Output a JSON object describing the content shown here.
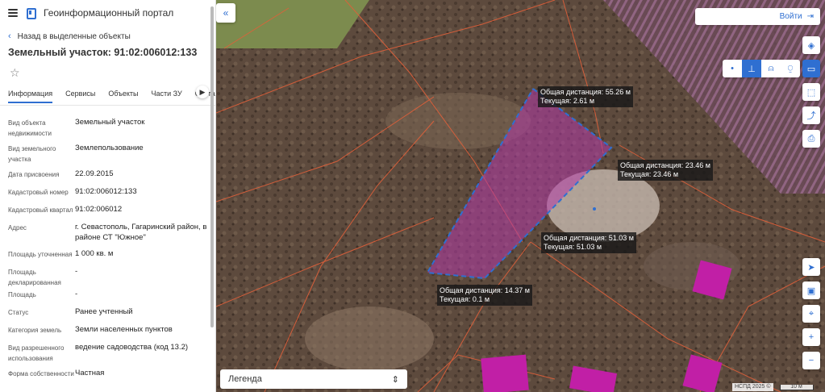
{
  "header": {
    "portal_title": "Геоинформационный портал"
  },
  "nav": {
    "back_label": "Назад в выделенные объекты"
  },
  "object": {
    "title": "Земельный участок: 91:02:006012:133"
  },
  "tabs": [
    {
      "label": "Информация",
      "active": true
    },
    {
      "label": "Сервисы"
    },
    {
      "label": "Объекты"
    },
    {
      "label": "Части ЗУ"
    },
    {
      "label": "Соста"
    }
  ],
  "properties": [
    {
      "label": "Вид объекта недвижимости",
      "value": "Земельный участок"
    },
    {
      "label": "Вид земельного участка",
      "value": "Землепользование"
    },
    {
      "label": "Дата присвоения",
      "value": "22.09.2015"
    },
    {
      "label": "Кадастровый номер",
      "value": "91:02:006012:133"
    },
    {
      "label": "Кадастровый квартал",
      "value": "91:02:006012"
    },
    {
      "label": "Адрес",
      "value": "г. Севастополь, Гагаринский район, в районе СТ \"Южное\""
    },
    {
      "label": "Площадь уточненная",
      "value": "1 000 кв. м"
    },
    {
      "label": "Площадь декларированная",
      "value": "-"
    },
    {
      "label": "Площадь",
      "value": "-"
    },
    {
      "label": "Статус",
      "value": "Ранее учтенный"
    },
    {
      "label": "Категория земель",
      "value": "Земли населенных пунктов"
    },
    {
      "label": "Вид разрешенного использования",
      "value": "ведение садоводства (код 13.2)"
    },
    {
      "label": "Форма собственности",
      "value": "Частная"
    }
  ],
  "map": {
    "login_label": "Войти",
    "legend_label": "Легенда",
    "scale_source": "НСПД 2025 ©",
    "scale_value": "10 м",
    "measurements": [
      {
        "total": "Общая дистанция: 55.26 м",
        "current": "Текущая: 2.61 м"
      },
      {
        "total": "Общая дистанция: 23.46 м",
        "current": "Текущая: 23.46 м"
      },
      {
        "total": "Общая дистанция: 51.03 м",
        "current": "Текущая: 51.03 м"
      },
      {
        "total": "Общая дистанция: 14.37 м",
        "current": "Текущая: 0.1 м"
      }
    ],
    "colors": {
      "accent": "#2f6fd1",
      "parcel_fill": "#b23aa8",
      "boundary_line": "#e0603a"
    }
  }
}
